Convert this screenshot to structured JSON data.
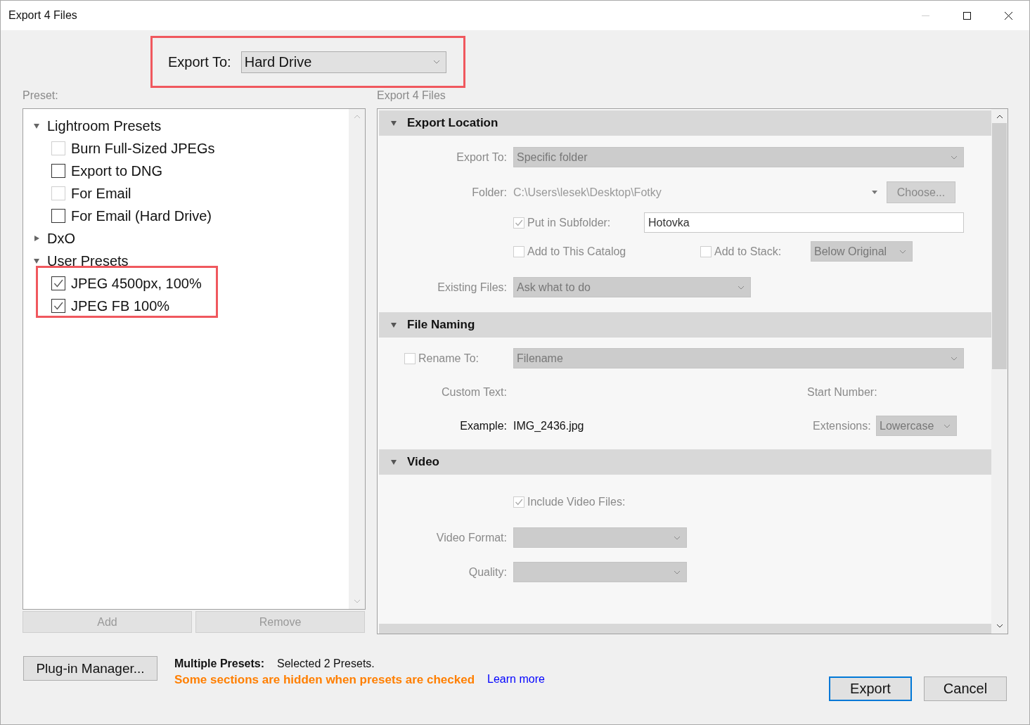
{
  "window": {
    "title": "Export 4 Files"
  },
  "export_to": {
    "label": "Export To:",
    "value": "Hard Drive"
  },
  "preset_panel": {
    "label": "Preset:",
    "groups": [
      {
        "label": "Lightroom Presets",
        "expanded": true,
        "children": [
          {
            "label": "Burn Full-Sized JPEGs",
            "checked": false,
            "disabled": true
          },
          {
            "label": "Export to DNG",
            "checked": false,
            "disabled": false
          },
          {
            "label": "For Email",
            "checked": false,
            "disabled": true
          },
          {
            "label": "For Email (Hard Drive)",
            "checked": false,
            "disabled": false
          }
        ]
      },
      {
        "label": "DxO",
        "expanded": false
      },
      {
        "label": "User Presets",
        "expanded": true,
        "children": [
          {
            "label": "JPEG 4500px, 100%",
            "checked": true,
            "disabled": false
          },
          {
            "label": "JPEG FB 100%",
            "checked": true,
            "disabled": false
          }
        ]
      }
    ],
    "buttons": [
      {
        "label": "Add",
        "disabled": true
      },
      {
        "label": "Remove",
        "disabled": true
      }
    ]
  },
  "settings_panel": {
    "label": "Export 4 Files",
    "export_location": {
      "title": "Export Location",
      "expanded": true,
      "export_to": {
        "label": "Export To:",
        "value": "Specific folder"
      },
      "folder": {
        "label": "Folder:",
        "value": "C:\\Users\\lesek\\Desktop\\Fotky",
        "button": "Choose..."
      },
      "subfolder": {
        "label": "Put in Subfolder:",
        "checked": true,
        "value": "Hotovka"
      },
      "add_to_catalog": {
        "label": "Add to This Catalog",
        "checked": false
      },
      "add_to_stack": {
        "label": "Add to Stack:",
        "checked": false,
        "value": "Below Original"
      },
      "existing_files": {
        "label": "Existing Files:",
        "value": "Ask what to do"
      }
    },
    "file_naming": {
      "title": "File Naming",
      "expanded": true,
      "rename_to": {
        "label": "Rename To:",
        "checked": false,
        "value": "Filename"
      },
      "custom_text": {
        "label": "Custom Text:"
      },
      "start_number": {
        "label": "Start Number:"
      },
      "example": {
        "label": "Example:",
        "value": "IMG_2436.jpg"
      },
      "extensions": {
        "label": "Extensions:",
        "value": "Lowercase"
      }
    },
    "video": {
      "title": "Video",
      "expanded": true,
      "include_video": {
        "label": "Include Video Files:",
        "checked": true
      },
      "video_format": {
        "label": "Video Format:"
      },
      "quality": {
        "label": "Quality:"
      }
    }
  },
  "footer": {
    "plugin_button": "Plug-in Manager...",
    "multiple_label": "Multiple Presets:",
    "multiple_value": "Selected 2 Presets.",
    "warning": "Some sections are hidden when presets are checked",
    "link": "Learn more",
    "buttons": [
      {
        "label": "Export",
        "default": true
      },
      {
        "label": "Cancel",
        "default": false
      }
    ]
  }
}
